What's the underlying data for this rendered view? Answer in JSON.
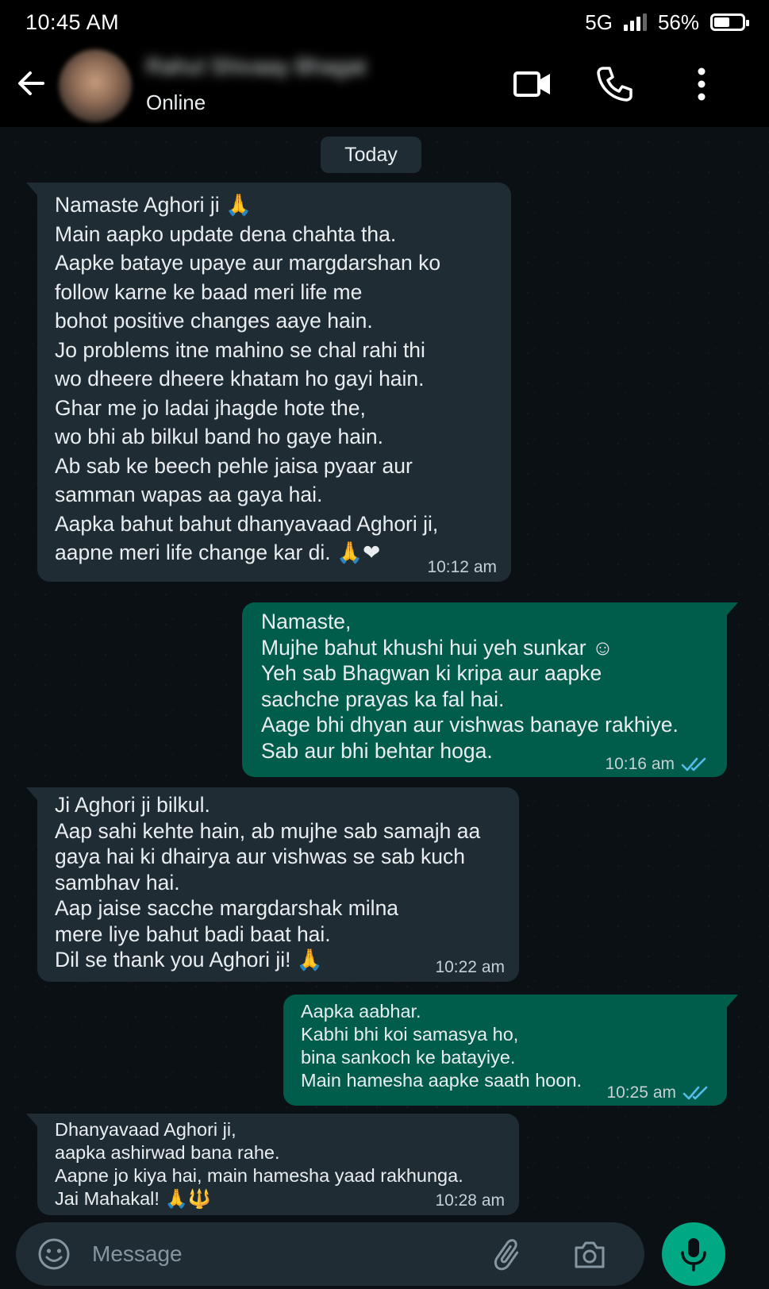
{
  "status_bar": {
    "time": "10:45 AM",
    "network": "5G",
    "battery": "56%",
    "battery_level": 0.56
  },
  "header": {
    "contact_name": "Rahul Shivaay Bhagat",
    "status": "Online"
  },
  "chat": {
    "date_chip": "Today",
    "messages": [
      {
        "direction": "incoming",
        "lines": [
          "Namaste Aghori ji 🙏",
          "Main aapko update dena chahta tha.",
          "Aapke bataye upaye aur margdarshan ko",
          "follow karne ke baad meri life me",
          "bohot positive changes aaye hain.",
          "Jo problems itne mahino se chal rahi thi",
          "wo dheere dheere khatam ho gayi hain.",
          "Ghar me jo ladai jhagde hote the,",
          "wo bhi ab bilkul band ho gaye hain.",
          "Ab sab ke beech pehle jaisa pyaar aur",
          "samman wapas aa gaya hai.",
          "Aapka bahut bahut dhanyavaad Aghori ji,",
          "aapne meri life change kar di. 🙏❤"
        ],
        "time": "10:12 am"
      },
      {
        "direction": "outgoing",
        "lines": [
          "Namaste,",
          "Mujhe bahut khushi hui yeh sunkar ☺",
          "Yeh sab Bhagwan ki kripa aur aapke",
          "sachche prayas ka fal hai.",
          "Aage bhi dhyan aur vishwas banaye rakhiye.",
          "Sab aur bhi behtar hoga."
        ],
        "time": "10:16 am",
        "read": true
      },
      {
        "direction": "incoming",
        "lines": [
          "Ji Aghori ji bilkul.",
          "Aap sahi kehte hain, ab mujhe sab samajh aa",
          "gaya hai ki dhairya aur vishwas se sab kuch",
          "sambhav hai.",
          "Aap jaise sacche margdarshak milna",
          "mere liye bahut badi baat hai.",
          "Dil se thank you Aghori ji! 🙏"
        ],
        "time": "10:22 am"
      },
      {
        "direction": "outgoing",
        "lines": [
          "Aapka aabhar.",
          "Kabhi bhi koi samasya ho,",
          "bina sankoch ke batayiye.",
          "Main hamesha aapke saath hoon."
        ],
        "time": "10:25 am",
        "read": true
      },
      {
        "direction": "incoming",
        "lines": [
          "Dhanyavaad Aghori ji,",
          "aapka ashirwad bana rahe.",
          "Aapne jo kiya hai, main hamesha yaad rakhunga.",
          "Jai Mahakal! 🙏🔱"
        ],
        "time": "10:28 am"
      }
    ]
  },
  "composer": {
    "placeholder": "Message"
  },
  "colors": {
    "background": "#0b1014",
    "incoming_bubble": "#1f2c34",
    "outgoing_bubble": "#005c4b",
    "accent_green": "#00a884",
    "read_tick_blue": "#53bdeb"
  },
  "icons": [
    "back-arrow-icon",
    "video-call-icon",
    "voice-call-icon",
    "more-options-icon",
    "emoji-icon",
    "attach-icon",
    "camera-icon",
    "mic-icon",
    "read-ticks-icon"
  ]
}
